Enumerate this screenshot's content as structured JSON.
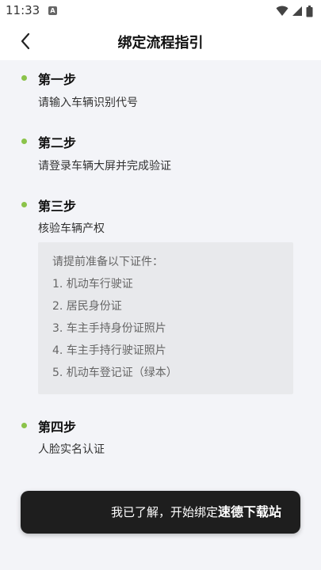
{
  "status_bar": {
    "time": "11:33",
    "app_icon_letter": "A"
  },
  "header": {
    "title": "绑定流程指引"
  },
  "steps": [
    {
      "title": "第一步",
      "desc": "请输入车辆识别代号"
    },
    {
      "title": "第二步",
      "desc": "请登录车辆大屏并完成验证"
    },
    {
      "title": "第三步",
      "desc": "核验车辆产权"
    },
    {
      "title": "第四步",
      "desc": "人脸实名认证"
    }
  ],
  "documents": {
    "intro": "请提前准备以下证件：",
    "items": [
      "1. 机动车行驶证",
      "2. 居民身份证",
      "3. 车主手持身份证照片",
      "4. 车主手持行驶证照片",
      "5. 机动车登记证（绿本）"
    ]
  },
  "action": {
    "label": "我已了解，开始绑定",
    "watermark": "速德下载站"
  },
  "colors": {
    "step_dot": "#8bc34a",
    "button_bg": "#1e1e1e",
    "page_bg": "#f3f4f8"
  },
  "icons": {
    "back": "chevron-left-icon",
    "wifi": "wifi-icon",
    "signal": "signal-icon",
    "battery": "battery-icon"
  }
}
